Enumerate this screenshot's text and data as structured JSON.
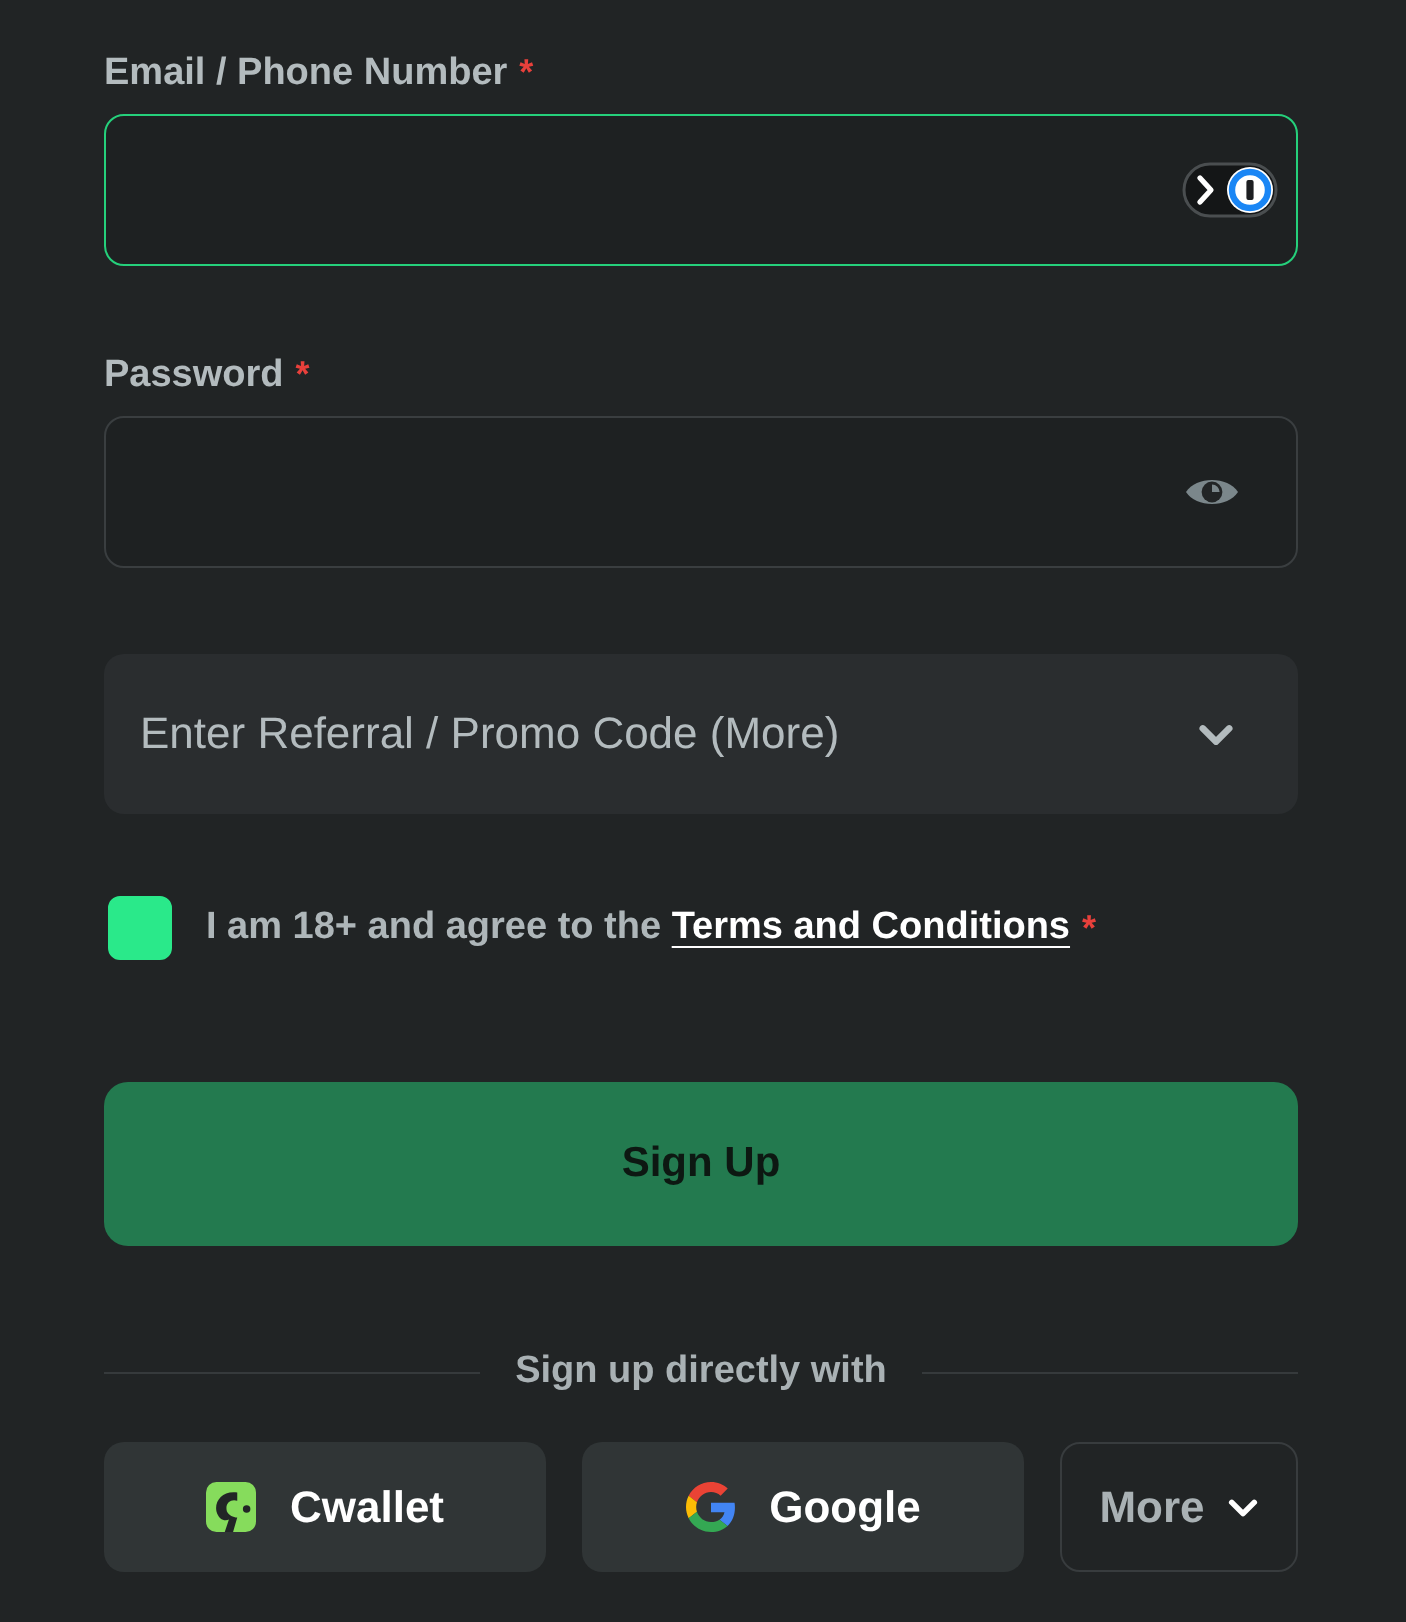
{
  "fields": [
    {
      "kind": "email",
      "label": "Email / Phone Number",
      "required_mark": "*",
      "focused": true
    },
    {
      "kind": "password",
      "label": "Password",
      "required_mark": "*",
      "focused": false
    }
  ],
  "referral": {
    "label": "Enter Referral / Promo Code (More)",
    "expanded": false
  },
  "agreement": {
    "checked": true,
    "text": "I am 18+ and agree to the",
    "link": "Terms and Conditions",
    "required_mark": "*"
  },
  "submit": {
    "label": "Sign Up"
  },
  "divider": "Sign up directly with",
  "providers": [
    {
      "kind": "cwallet",
      "label": "Cwallet"
    },
    {
      "kind": "google",
      "label": "Google"
    },
    {
      "kind": "more",
      "label": "More"
    }
  ]
}
